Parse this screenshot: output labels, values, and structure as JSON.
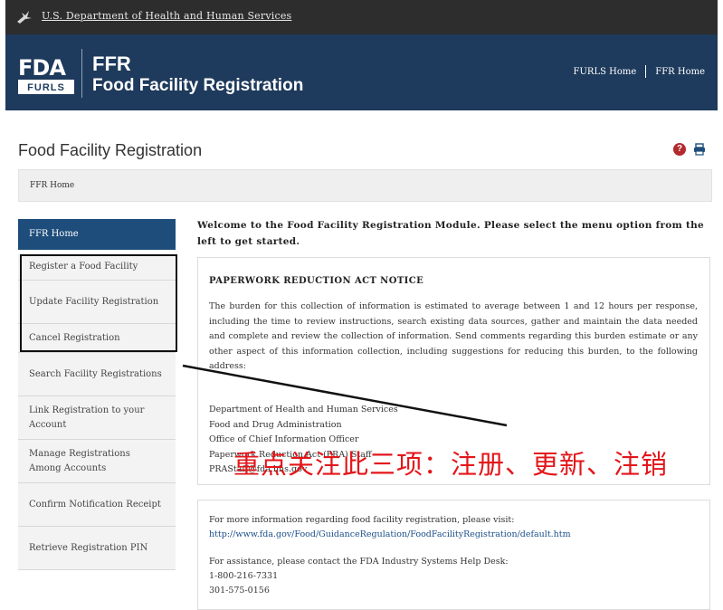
{
  "hhs_bar": {
    "label": "U.S. Department of Health and Human Services"
  },
  "header": {
    "logo_top": "FDA",
    "logo_bottom": "FURLS",
    "app_short": "FFR",
    "app_long": "Food Facility Registration",
    "links": [
      "FURLS Home",
      "FFR Home"
    ]
  },
  "page": {
    "title": "Food Facility Registration",
    "breadcrumb": "FFR Home",
    "help_icon": "question-circle-icon",
    "print_icon": "printer-icon"
  },
  "sidebar": {
    "items": [
      {
        "label": "FFR Home",
        "active": true
      },
      {
        "label": "Register a Food Facility"
      },
      {
        "label": "Update Facility Registration"
      },
      {
        "label": "Cancel Registration"
      },
      {
        "label": "Search Facility Registrations"
      },
      {
        "label": "Link Registration to your Account"
      },
      {
        "label": "Manage Registrations Among Accounts"
      },
      {
        "label": "Confirm Notification Receipt"
      },
      {
        "label": "Retrieve Registration PIN"
      }
    ]
  },
  "main": {
    "welcome": "Welcome to the Food Facility Registration Module. Please select the menu option from the left to get started.",
    "paperwork": {
      "heading": "PAPERWORK REDUCTION ACT NOTICE",
      "body": "The burden for this collection of information is estimated to average between 1 and 12 hours per response, including the time to review instructions, search existing data sources, gather and maintain the data needed and complete and review the collection of information. Send comments regarding this burden estimate or any other aspect of this information collection, including suggestions for reducing this burden, to the following address:",
      "address": [
        "Department of Health and Human Services",
        "Food and Drug Administration",
        "Office of Chief Information Officer",
        "Paperwork Reduction Act (PRA) Staff",
        "PRAStaff@fda.hhs.gov"
      ]
    },
    "info": {
      "more_info": "For more information regarding food facility registration, please visit:",
      "url": "http://www.fda.gov/Food/GuidanceRegulation/FoodFacilityRegistration/default.htm",
      "assistance": "For assistance, please contact the FDA Industry Systems Help Desk:",
      "phone1": "1-800-216-7331",
      "phone2": "301-575-0156"
    }
  },
  "annotation": {
    "text": "重点关注此三项：注册、更新、注销",
    "color": "#e3161a"
  },
  "colors": {
    "hhs_bar": "#2d2d2d",
    "header": "#1e3a5c",
    "sidebar_active": "#1e4d7b",
    "help_icon": "#b2292e"
  }
}
